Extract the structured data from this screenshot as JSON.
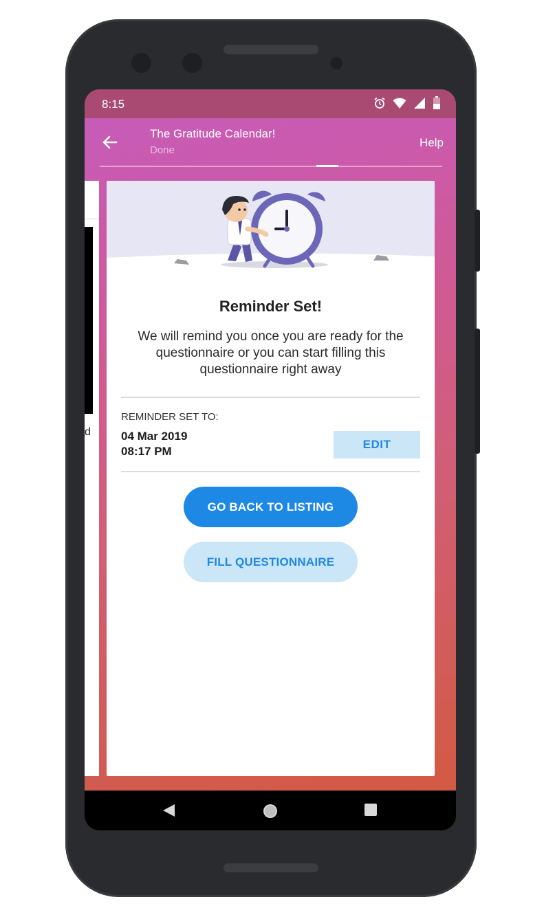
{
  "status_bar": {
    "time": "8:15",
    "icons": [
      "alarm-icon",
      "wifi-icon",
      "cell-signal-icon",
      "battery-icon"
    ]
  },
  "app_bar": {
    "title": "The Gratitude Calendar!",
    "subtitle": "Done",
    "help_label": "Help"
  },
  "progress": {
    "current_fraction": 0.7
  },
  "previous_card": {
    "fragment_text": "d"
  },
  "card": {
    "title": "Reminder Set!",
    "message": "We will remind you once you are ready for the questionnaire or you can start filling this questionnaire right away",
    "reminder_label": "REMINDER SET TO:",
    "reminder_date": "04 Mar 2019",
    "reminder_time": "08:17 PM",
    "edit_label": "EDIT",
    "primary_button": "GO BACK TO LISTING",
    "secondary_button": "FILL QUESTIONNAIRE"
  },
  "colors": {
    "accent": "#1e88e5",
    "accent_light": "#cbe6f7",
    "status_bar": "#a84a72",
    "gradient_top": "#c65bbd",
    "gradient_bottom": "#d35a43"
  },
  "nav_bar": {
    "icons": [
      "back-triangle-icon",
      "home-circle-icon",
      "recents-square-icon"
    ]
  }
}
